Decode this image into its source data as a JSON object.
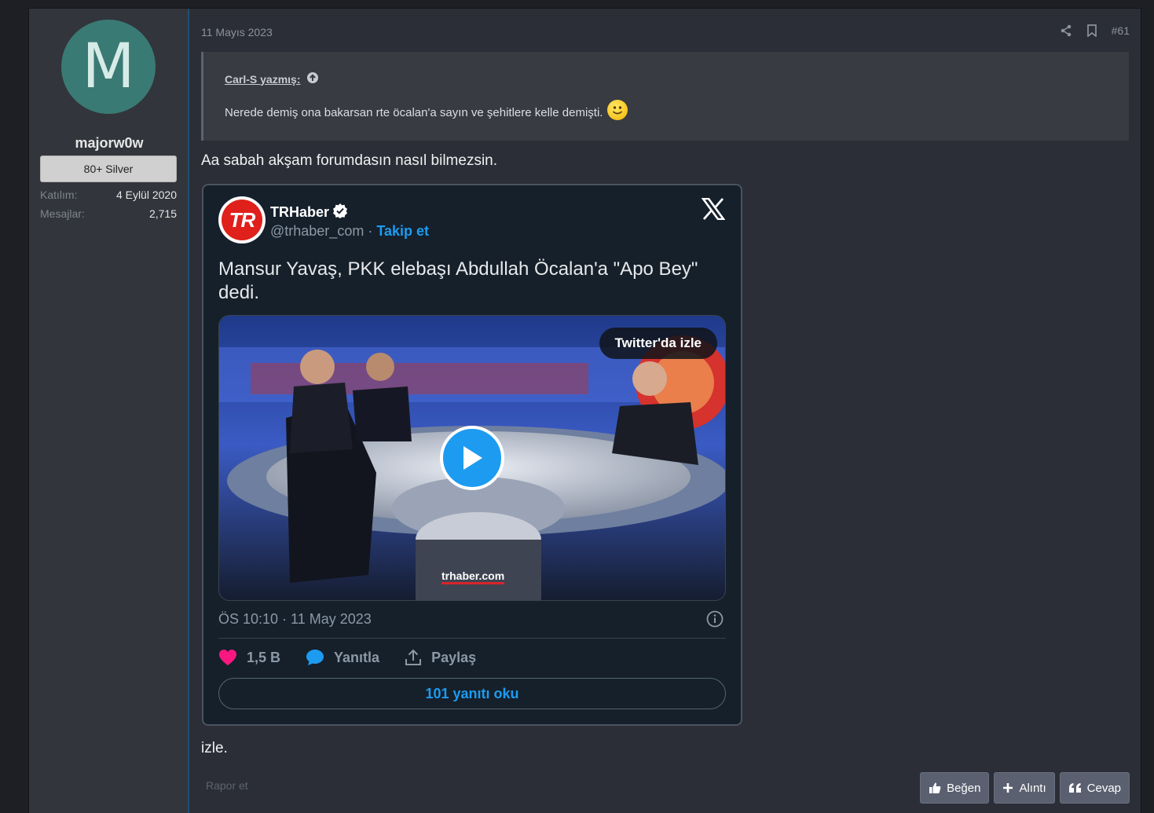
{
  "user": {
    "avatar_letter": "M",
    "username": "majorw0w",
    "rank": "80+ Silver",
    "joined_label": "Katılım:",
    "joined_value": "4 Eylül 2020",
    "messages_label": "Mesajlar:",
    "messages_value": "2,715",
    "avatar_color": "#3a7a74"
  },
  "post": {
    "date": "11 Mayıs 2023",
    "number": "#61",
    "quote_author": "Carl-S yazmış:",
    "quote_text": "Nerede demiş ona bakarsan rte öcalan'a sayın ve şehitlere kelle demişti.",
    "reply_text": "Aa sabah akşam forumdasın nasıl bilmezsin.",
    "footer_text": "izle.",
    "report_label": "Rapor et",
    "like_label": "Beğen",
    "quote_label": "Alıntı",
    "reply_label": "Cevap"
  },
  "tweet": {
    "avatar_text": "TR",
    "name": "TRHaber",
    "handle": "@trhaber_com",
    "separator": "·",
    "follow_label": "Takip et",
    "text": "Mansur Yavaş, PKK elebaşı Abdullah Öcalan'a \"Apo Bey\" dedi.",
    "watch_label": "Twitter'da izle",
    "media_watermark": "trhaber.com",
    "timestamp": "ÖS 10:10 · 11 May 2023",
    "likes": "1,5 B",
    "reply_label": "Yanıtla",
    "share_label": "Paylaş",
    "read_replies": "101 yanıtı oku",
    "accent_color": "#1d9bf0",
    "like_color": "#f91880"
  }
}
